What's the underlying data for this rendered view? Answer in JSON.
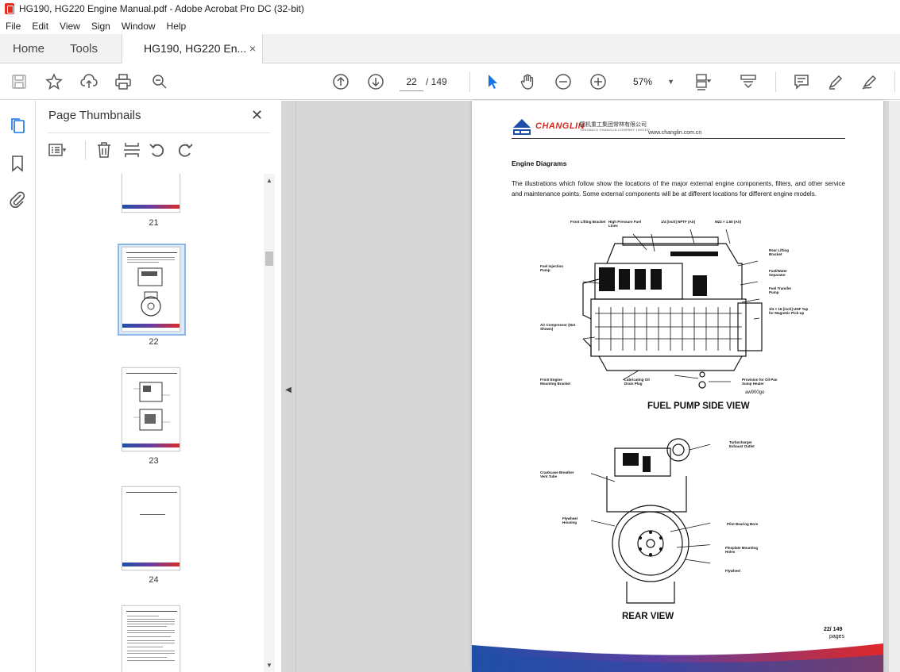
{
  "window": {
    "title": "HG190, HG220 Engine Manual.pdf - Adobe Acrobat Pro DC (32-bit)"
  },
  "menu": [
    "File",
    "Edit",
    "View",
    "Sign",
    "Window",
    "Help"
  ],
  "tabs": {
    "home": "Home",
    "tools": "Tools",
    "document": "HG190, HG220 En...",
    "close": "×"
  },
  "toolbar": {
    "current_page": "22",
    "page_total": "/ 149",
    "zoom": "57%"
  },
  "panel": {
    "title": "Page Thumbnails",
    "close": "✕",
    "thumbnails": [
      {
        "page": "21"
      },
      {
        "page": "22",
        "selected": true
      },
      {
        "page": "23"
      },
      {
        "page": "24"
      }
    ]
  },
  "document": {
    "brand": "CHANGLIN",
    "cn_name": "国机重工集团常林有限公司",
    "cn_sub": "SINOMACH CHANGLIN COMPANY LIMITED",
    "website": "www.changlin.com.cn",
    "heading": "Engine Diagrams",
    "paragraph": "The illustrations which follow show the locations of the major external engine components, filters, and other service and maintenance points. Some external components will be at different locations for different engine models.",
    "diagram1": {
      "caption": "FUEL PUMP SIDE VIEW",
      "labels": {
        "front_lifting": "Front Lifting Bracket",
        "hp_fuel": "High Pressure Fuel Lines",
        "npt": "1/4 [inch] NPTF (Air)",
        "m22": "M22 × 1.50 (Air)",
        "rear_lifting": "Rear Lifting Bracket",
        "fuel_water": "Fuel/Water Separator",
        "fuel_transfer": "Fuel Transfer Pump",
        "unf_tap": "3/4 × 16 [inch] UNF Tap for Magnetic Pick-up",
        "fuel_injection": "Fuel Injection Pump",
        "air_compressor": "Air Compressor (Not Shown)",
        "front_engine": "Front Engine Mounting Bracket",
        "lube_drain": "Lubricating Oil Drain Plug",
        "provision": "Provision for Oil Pan Sump Heater",
        "code": "aw900go"
      }
    },
    "diagram2": {
      "caption": "REAR VIEW",
      "labels": {
        "turbo": "Turbocharger Exhaust Outlet",
        "breather": "Crankcase Breather Vent Tube",
        "flywheel_housing": "Flywheel Housing",
        "pilot_bore": "Pilot Bearing Bore",
        "flexplate": "Flexplate Mounting Holes",
        "flywheel": "Flywheel"
      }
    },
    "page_footer": "22/ 149",
    "page_footer_2": "pages"
  },
  "colors": {
    "brand_red": "#d42a20",
    "brand_blue": "#1f4fa8",
    "accent_blue": "#1473e6"
  }
}
